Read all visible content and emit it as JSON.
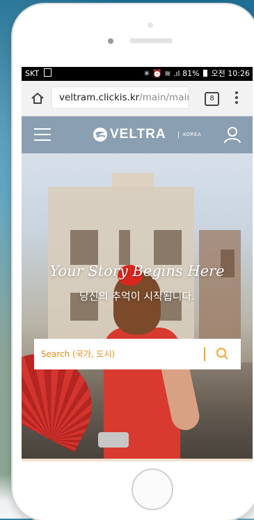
{
  "status_bar": {
    "carrier": "SKT",
    "indicators": "✳ ⏰ ≋ .ıl",
    "battery": "81%",
    "time": "오전 10:26"
  },
  "browser": {
    "url_host": "veltram.clickis.kr",
    "url_path": "/main/main.",
    "tab_count": "8"
  },
  "site_header": {
    "logo_text": "VELTRA",
    "logo_separator": "|",
    "logo_region": "KOREA"
  },
  "hero": {
    "tagline_en": "Your Story Begins Here",
    "tagline_ko": "당신의 추억이 시작됩니다."
  },
  "search": {
    "placeholder": "Search (국가, 도시)"
  },
  "colors": {
    "header_bg": "#8a9fb2",
    "search_accent": "#f1a534",
    "status_bar": "#000000"
  }
}
